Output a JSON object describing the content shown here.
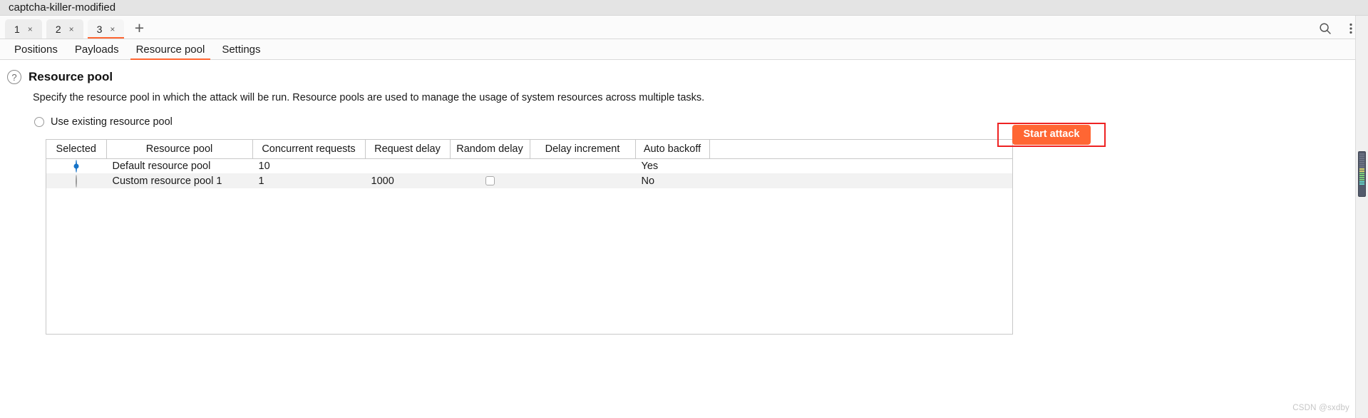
{
  "window": {
    "title": "captcha-killer-modified"
  },
  "tabstrip": {
    "tabs": [
      {
        "label": "1",
        "close": "×",
        "active": false
      },
      {
        "label": "2",
        "close": "×",
        "active": false
      },
      {
        "label": "3",
        "close": "×",
        "active": true
      }
    ],
    "add_label": "+",
    "search_icon": "search-icon",
    "menu_icon": "more-vertical-icon"
  },
  "navtabs": [
    {
      "label": "Positions",
      "active": false
    },
    {
      "label": "Payloads",
      "active": false
    },
    {
      "label": "Resource pool",
      "active": true
    },
    {
      "label": "Settings",
      "active": false
    }
  ],
  "section": {
    "help_icon": "?",
    "title": "Resource pool",
    "description": "Specify the resource pool in which the attack will be run. Resource pools are used to manage the usage of system resources across multiple tasks."
  },
  "options": {
    "use_existing_label": "Use existing resource pool",
    "use_existing_checked": false
  },
  "table": {
    "columns": [
      "Selected",
      "Resource pool",
      "Concurrent requests",
      "Request delay",
      "Random delay",
      "Delay increment",
      "Auto backoff"
    ],
    "rows": [
      {
        "selected": true,
        "resource_pool": "Default resource pool",
        "concurrent_requests": "10",
        "request_delay": "",
        "random_delay": "",
        "random_delay_checkbox": false,
        "delay_increment": "",
        "auto_backoff": "Yes"
      },
      {
        "selected": false,
        "resource_pool": "Custom resource pool 1",
        "concurrent_requests": "1",
        "request_delay": "1000",
        "random_delay": "",
        "random_delay_checkbox": true,
        "delay_increment": "",
        "auto_backoff": "No"
      }
    ]
  },
  "actions": {
    "start_attack_label": "Start attack",
    "start_attack_color": "#ff6633",
    "highlight_color": "#ee2222"
  },
  "watermark": {
    "text": "CSDN @sxdby"
  }
}
